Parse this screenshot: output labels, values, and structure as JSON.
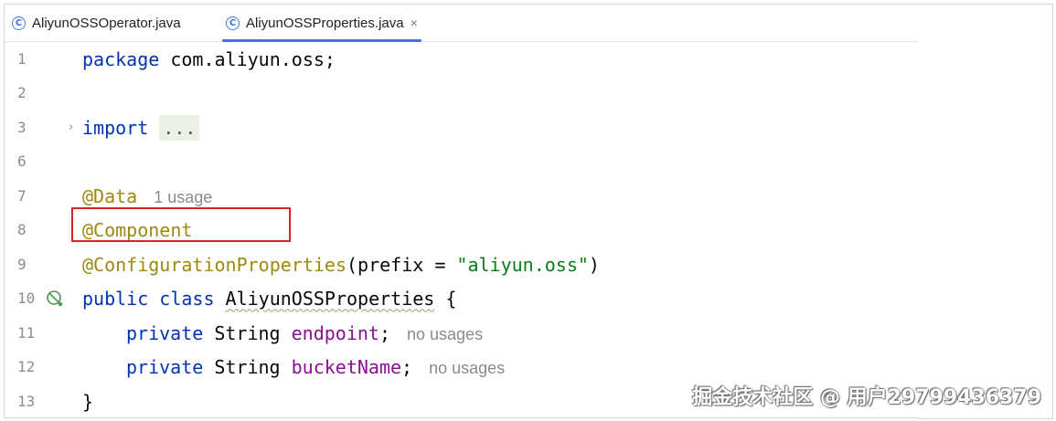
{
  "tabs": [
    {
      "label": "AliyunOSSOperator.java",
      "active": false,
      "icon": "class-icon"
    },
    {
      "label": "AliyunOSSProperties.java",
      "active": true,
      "icon": "class-icon",
      "close": "×"
    }
  ],
  "lines": [
    {
      "num": "1",
      "code": {
        "kw": "package",
        "rest": " com.aliyun.oss;"
      }
    },
    {
      "num": "2"
    },
    {
      "num": "3",
      "code": {
        "kw": "import",
        "fold": "..."
      }
    },
    {
      "num": "6"
    },
    {
      "num": "7",
      "code": {
        "ann": "@Data",
        "hint": "1 usage"
      }
    },
    {
      "num": "8",
      "code": {
        "ann": "@Component"
      }
    },
    {
      "num": "9",
      "code": {
        "ann": "@ConfigurationProperties",
        "open": "(prefix = ",
        "str": "\"aliyun.oss\"",
        "close": ")"
      }
    },
    {
      "num": "10",
      "code": {
        "kw": "public class",
        "cls": "AliyunOSSProperties",
        "rest": " {"
      }
    },
    {
      "num": "11",
      "code": {
        "kw": "private",
        "type": " String ",
        "field": "endpoint",
        "semi": ";",
        "hint": "no usages"
      }
    },
    {
      "num": "12",
      "code": {
        "kw": "private",
        "type": " String ",
        "field": "bucketName",
        "semi": ";",
        "hint": "no usages"
      }
    },
    {
      "num": "13",
      "code": {
        "rest": "}"
      }
    }
  ],
  "watermark": "掘金技术社区 @ 用户29799436379",
  "colors": {
    "keyword": "#0033b3",
    "annotation": "#9e880d",
    "string": "#067d17",
    "field": "#871094",
    "highlight_box": "#d0252b",
    "tab_underline": "#3574f0"
  }
}
